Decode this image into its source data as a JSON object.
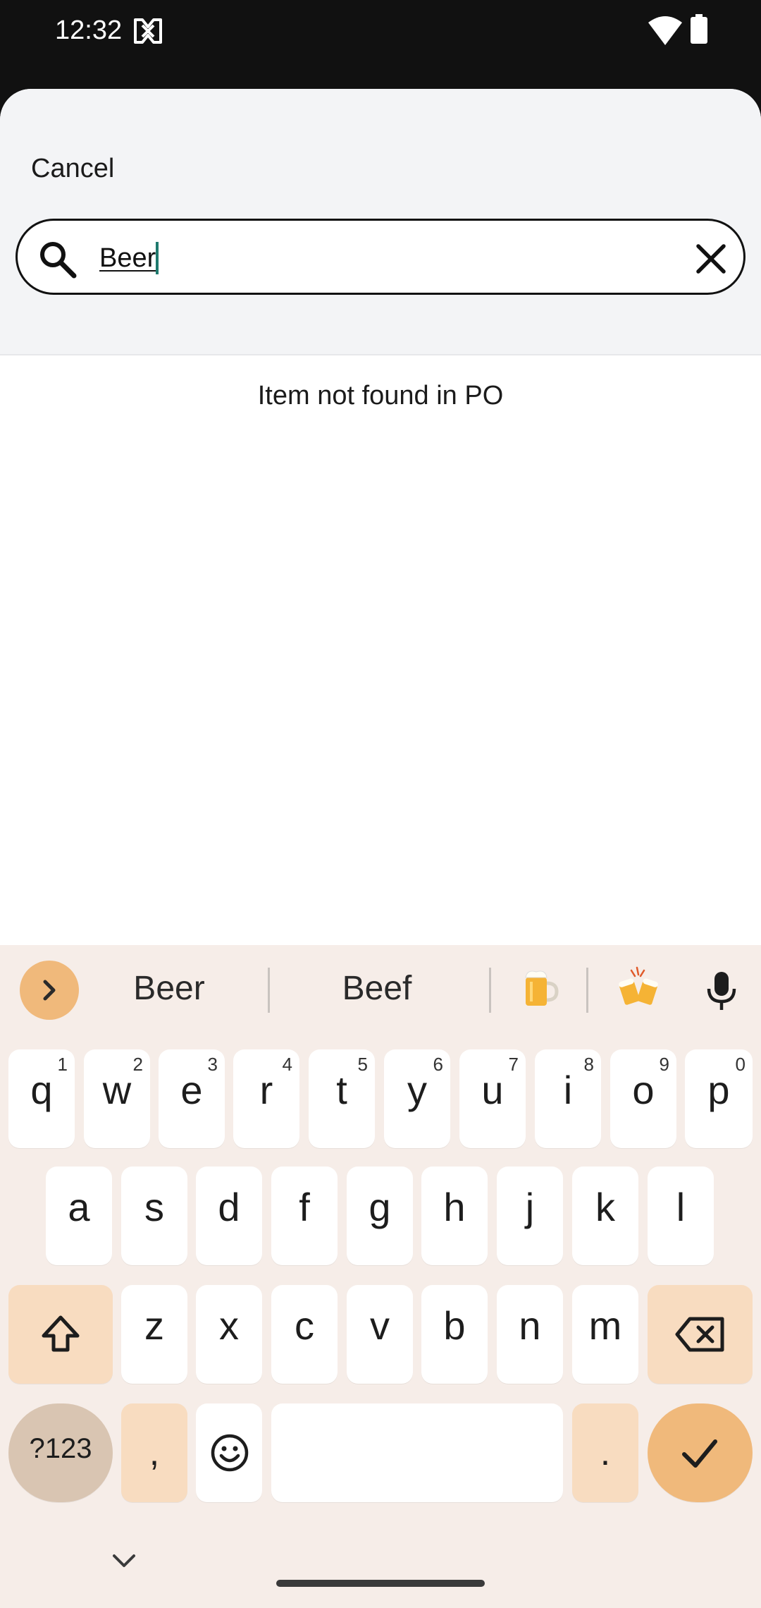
{
  "status_bar": {
    "time": "12:32"
  },
  "sheet": {
    "cancel_label": "Cancel",
    "search": {
      "value": "Beer",
      "placeholder": ""
    },
    "message": "Item not found in PO"
  },
  "keyboard": {
    "suggestions": [
      "Beer",
      "Beef"
    ],
    "emoji_suggestions": [
      "beer-mug-emoji",
      "clinking-beer-mugs-emoji"
    ],
    "row1": [
      {
        "k": "q",
        "h": "1"
      },
      {
        "k": "w",
        "h": "2"
      },
      {
        "k": "e",
        "h": "3"
      },
      {
        "k": "r",
        "h": "4"
      },
      {
        "k": "t",
        "h": "5"
      },
      {
        "k": "y",
        "h": "6"
      },
      {
        "k": "u",
        "h": "7"
      },
      {
        "k": "i",
        "h": "8"
      },
      {
        "k": "o",
        "h": "9"
      },
      {
        "k": "p",
        "h": "0"
      }
    ],
    "row2": [
      "a",
      "s",
      "d",
      "f",
      "g",
      "h",
      "j",
      "k",
      "l"
    ],
    "row3": [
      "z",
      "x",
      "c",
      "v",
      "b",
      "n",
      "m"
    ],
    "symbols_label": "?123",
    "comma_label": ",",
    "period_label": ".",
    "colors": {
      "background": "#f6ede8",
      "accent": "#f0b97b",
      "function_key": "#f8dcc0",
      "symbols_key": "#d9c5b2"
    }
  }
}
